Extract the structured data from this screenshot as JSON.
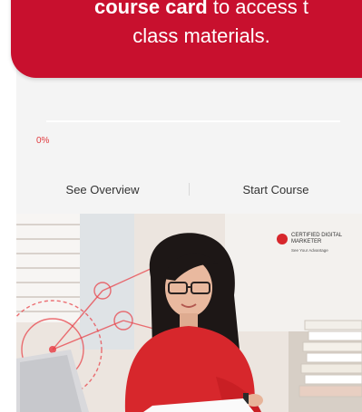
{
  "tooltip": {
    "bold": "course card",
    "rest_line1": " to access t",
    "line2": "class materials."
  },
  "course_card": {
    "progress_label": "0%",
    "progress_value": 0,
    "see_overview_label": "See Overview",
    "start_course_label": "Start Course",
    "image": {
      "badge_line1": "CERTIFIED DIGITAL",
      "badge_line2": "MARKETER",
      "badge_tagline": "See Your Advantage"
    }
  },
  "colors": {
    "accent": "#c8102e",
    "progress_text": "#e03a3e",
    "card_bg": "#f4f4f4"
  }
}
